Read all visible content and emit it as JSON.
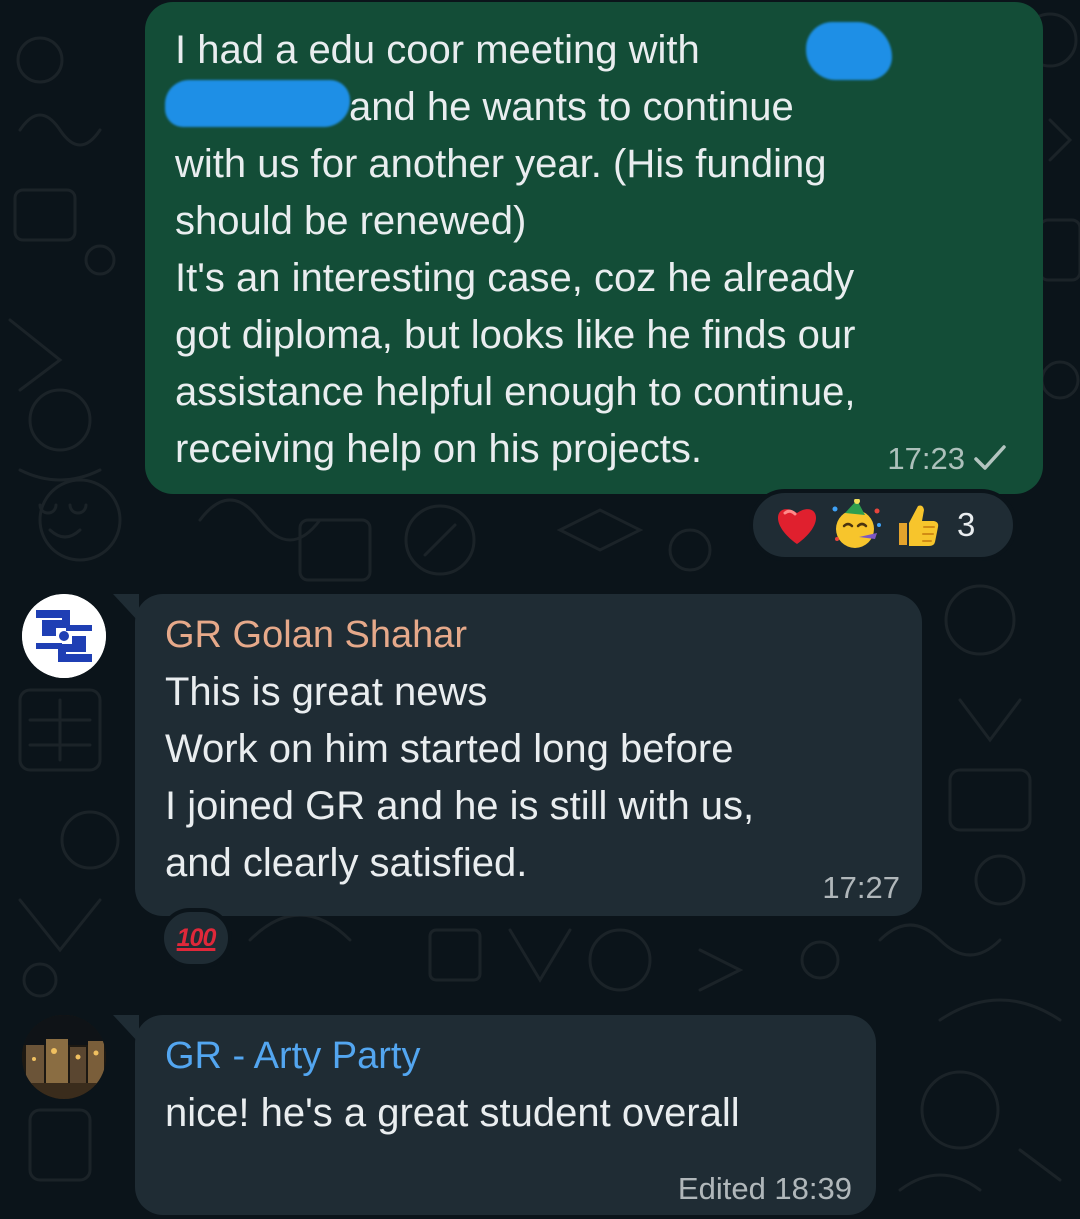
{
  "messages": [
    {
      "direction": "outgoing",
      "text_lines": [
        "I had a edu coor meeting with",
        "and he wants to continue",
        "with us for another year. (His funding",
        "should be renewed)",
        "It's an interesting case, coz he already",
        "got diploma, but looks like he finds our",
        "assistance helpful enough to continue,",
        "receiving help on his projects."
      ],
      "time": "17:23",
      "status_icon": "single-check-icon",
      "reactions": {
        "emojis": [
          "red-heart-icon",
          "partying-face-icon",
          "thumbs-up-icon"
        ],
        "count": "3"
      }
    },
    {
      "direction": "incoming",
      "sender": "GR Golan Shahar",
      "sender_color": "#e6a98a",
      "avatar_icon": "gs-logo-icon",
      "text_lines": [
        "This is great news",
        "Work on him started long before",
        "I joined GR and he is still with us,",
        "and clearly satisfied."
      ],
      "time": "17:27",
      "reaction": "100"
    },
    {
      "direction": "incoming",
      "sender": "GR - Arty Party",
      "sender_color": "#53a6f0",
      "avatar_icon": "group-photo-icon",
      "text_lines": [
        "nice! he's a great student overall"
      ],
      "time": "Edited 18:39"
    }
  ],
  "colors": {
    "background": "#0b141a",
    "outgoing_bubble": "#134d37",
    "incoming_bubble": "#1f2c34",
    "text": "#e9edef",
    "redaction": "#1e8fe6"
  }
}
